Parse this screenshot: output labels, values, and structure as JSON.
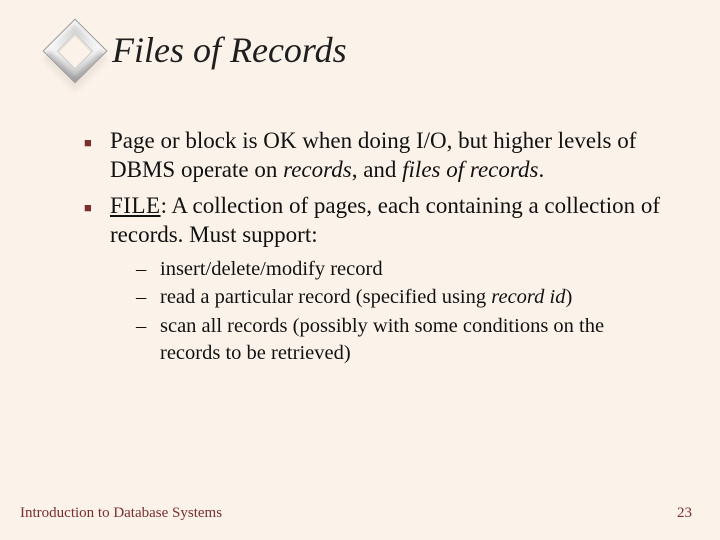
{
  "title": "Files of Records",
  "bullets": [
    {
      "pre": "Page or block is OK when doing I/O, but higher levels of DBMS operate on ",
      "em1": "records",
      "mid": ", and ",
      "em2": "files of records",
      "post": "."
    },
    {
      "file_label": "FILE",
      "rest": ": A collection of pages, each containing a collection of records. Must support:"
    }
  ],
  "subitems": [
    {
      "text": "insert/delete/modify record"
    },
    {
      "pre": "read a particular record (specified using ",
      "em": "record id",
      "post": ")"
    },
    {
      "text": "scan all records (possibly with some conditions on the records to be retrieved)"
    }
  ],
  "footer": {
    "left": "Introduction to Database Systems",
    "right": "23"
  },
  "colors": {
    "accent": "#7a2e2e",
    "bg": "#fbf2e9"
  }
}
